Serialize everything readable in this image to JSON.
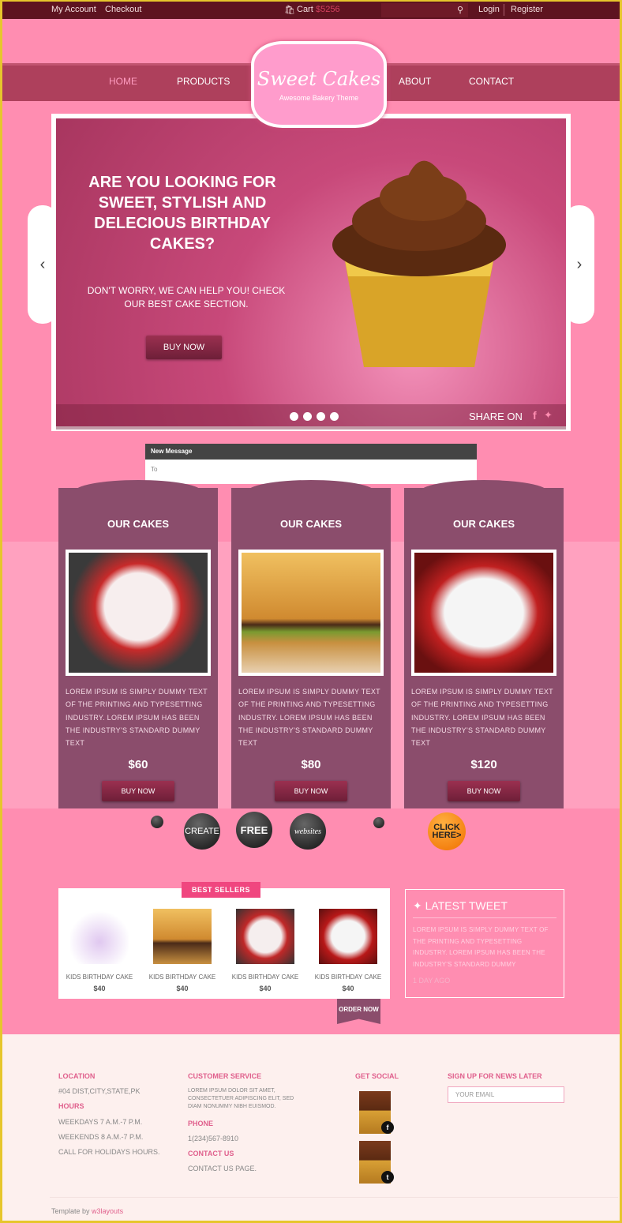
{
  "topbar": {
    "my_account": "My Account",
    "checkout": "Checkout",
    "cart_label": "Cart",
    "cart_amount": "$5256",
    "login": "Login",
    "register": "Register"
  },
  "nav": {
    "items": [
      "HOME",
      "PRODUCTS",
      "ABOUT",
      "CONTACT"
    ],
    "active": "HOME"
  },
  "logo": {
    "title": "Sweet Cakes",
    "tagline": "Awesome Bakery Theme"
  },
  "slider": {
    "heading": "ARE YOU LOOKING FOR SWEET, STYLISH AND DELECIOUS BIRTHDAY CAKES?",
    "text": "DON'T WORRY, WE CAN HELP YOU! CHECK OUR BEST CAKE SECTION.",
    "button": "BUY NOW",
    "share": "SHARE ON",
    "slides": 4
  },
  "ad_message": {
    "header": "New Message",
    "to": "To"
  },
  "cards": [
    {
      "title": "OUR CAKES",
      "desc": "LOREM IPSUM IS SIMPLY DUMMY TEXT OF THE PRINTING AND TYPESETTING INDUSTRY. LOREM IPSUM HAS BEEN THE INDUSTRY'S STANDARD DUMMY TEXT",
      "price": "$60",
      "button": "BUY NOW"
    },
    {
      "title": "OUR CAKES",
      "desc": "LOREM IPSUM IS SIMPLY DUMMY TEXT OF THE PRINTING AND TYPESETTING INDUSTRY. LOREM IPSUM HAS BEEN THE INDUSTRY'S STANDARD DUMMY TEXT",
      "price": "$80",
      "button": "BUY NOW"
    },
    {
      "title": "OUR CAKES",
      "desc": "LOREM IPSUM IS SIMPLY DUMMY TEXT OF THE PRINTING AND TYPESETTING INDUSTRY. LOREM IPSUM HAS BEEN THE INDUSTRY'S STANDARD DUMMY TEXT",
      "price": "$120",
      "button": "BUY NOW"
    }
  ],
  "ad_banner": {
    "words": [
      "CREATE",
      "FREE",
      "websites"
    ],
    "cta": "CLICK HERE>"
  },
  "best_sellers": {
    "label": "BEST SELLERS",
    "items": [
      {
        "name": "KIDS BIRTHDAY CAKE",
        "price": "$40"
      },
      {
        "name": "KIDS BIRTHDAY CAKE",
        "price": "$40"
      },
      {
        "name": "KIDS BIRTHDAY CAKE",
        "price": "$40"
      },
      {
        "name": "KIDS BIRTHDAY CAKE",
        "price": "$40"
      }
    ],
    "order": "ORDER NOW"
  },
  "tweet": {
    "title": "LATEST TWEET",
    "body": "LOREM IPSUM IS SIMPLY DUMMY TEXT OF THE PRINTING AND TYPESETTING INDUSTRY. LOREM IPSUM HAS BEEN THE INDUSTRY'S STANDARD DUMMY",
    "ago": "1 DAY AGO"
  },
  "footer": {
    "location_h": "LOCATION",
    "location": "#04 DIST,CITY,STATE,PK",
    "hours_h": "HOURS",
    "hours": [
      "WEEKDAYS 7 A.M.-7 P.M.",
      "WEEKENDS 8 A.M.-7 P.M.",
      "CALL FOR HOLIDAYS HOURS."
    ],
    "service_h": "CUSTOMER SERVICE",
    "service": "LOREM IPSUM DOLOR SIT AMET, CONSECTETUER ADIPISCING ELIT, SED DIAM NONUMMY NIBH EUISMOD.",
    "phone_h": "PHONE",
    "phone": "1(234)567-8910",
    "contact_h": "CONTACT US",
    "contact": "CONTACT US PAGE.",
    "social_h": "GET SOCIAL",
    "news_h": "SIGN UP FOR NEWS LATER",
    "email_placeholder": "YOUR EMAIL",
    "credit": "Template by",
    "credit_link": "w3layouts"
  },
  "colors": {
    "topbar": "#5e1320",
    "page": "#ff8db1",
    "nav": "#ae405c",
    "card": "#8b4d6c",
    "accent": "#f0467f",
    "footer": "#fdf0ee"
  }
}
